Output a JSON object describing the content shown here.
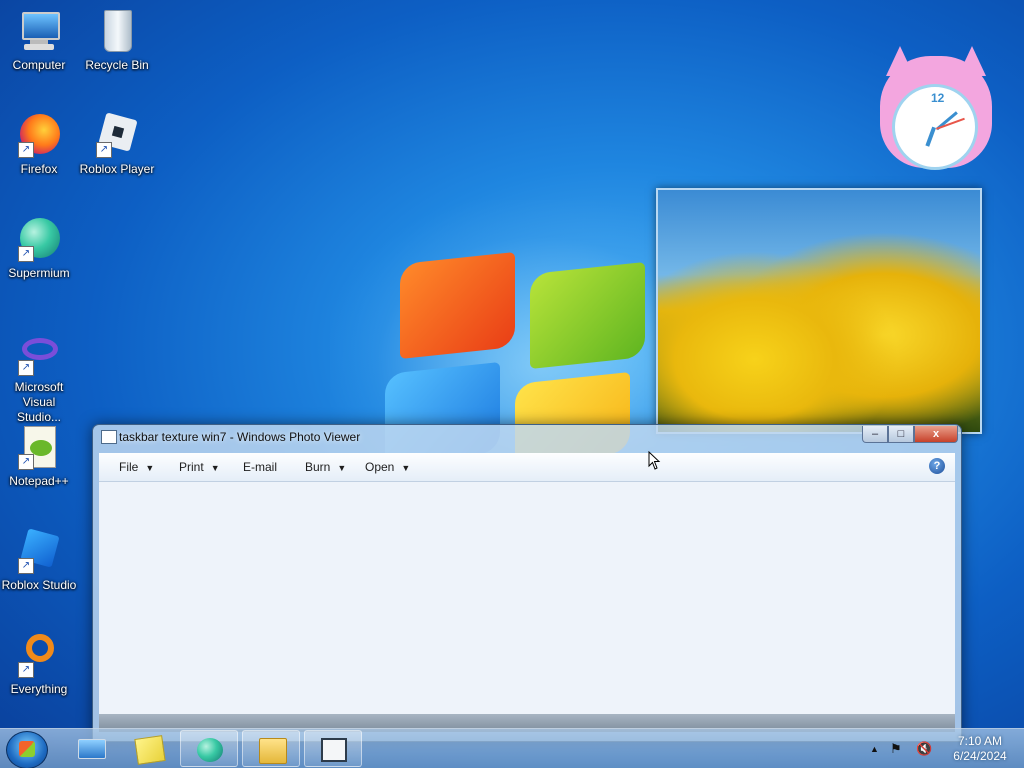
{
  "desktop": {
    "icons": [
      {
        "label": "Computer",
        "icon": "computer-icon"
      },
      {
        "label": "Recycle Bin",
        "icon": "recycle-bin-icon"
      },
      {
        "label": "Firefox",
        "icon": "firefox-icon"
      },
      {
        "label": "Roblox Player",
        "icon": "roblox-player-icon"
      },
      {
        "label": "Supermium",
        "icon": "supermium-icon"
      },
      {
        "label": "Microsoft Visual Studio...",
        "icon": "visual-studio-icon"
      },
      {
        "label": "Notepad++",
        "icon": "notepadpp-icon"
      },
      {
        "label": "Roblox Studio",
        "icon": "roblox-studio-icon"
      },
      {
        "label": "Everything",
        "icon": "everything-icon"
      }
    ]
  },
  "gadgets": {
    "clock": {
      "number": "12"
    }
  },
  "window": {
    "title": "taskbar texture win7 - Windows Photo Viewer",
    "controls": {
      "minimize": "–",
      "maximize": "□",
      "close": "x"
    },
    "menu": {
      "file": "File",
      "print": "Print",
      "email": "E-mail",
      "burn": "Burn",
      "open": "Open",
      "help": "?"
    }
  },
  "taskbar": {
    "buttons": [
      {
        "name": "remote-desktop-icon"
      },
      {
        "name": "sticky-notes-icon"
      },
      {
        "name": "supermium-icon"
      },
      {
        "name": "file-explorer-icon"
      },
      {
        "name": "photo-viewer-icon"
      }
    ],
    "tray": {
      "time": "7:10 AM",
      "date": "6/24/2024"
    }
  },
  "colors": {
    "accent": "#1f86e0",
    "close_button": "#c7412a"
  }
}
